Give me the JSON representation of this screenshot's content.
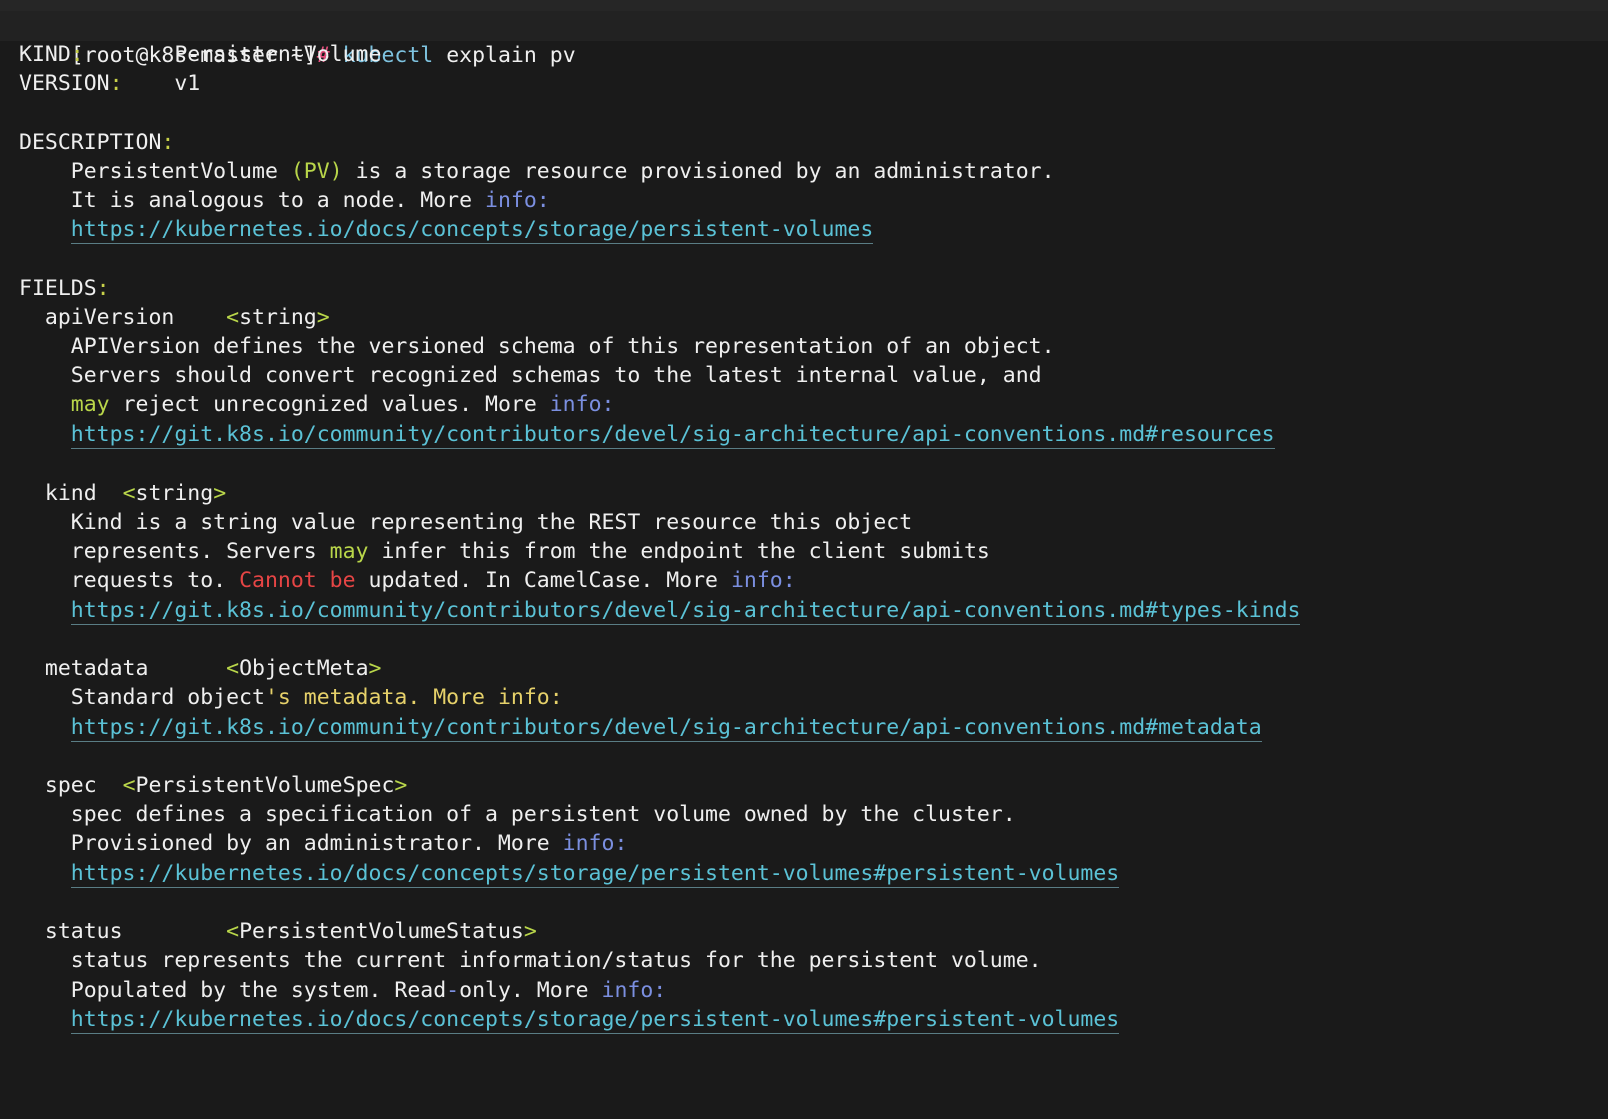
{
  "prompt": {
    "user_host": "[root@k8s-master ~]",
    "hash": "#",
    "command": "kubectl",
    "args": "explain pv"
  },
  "header": {
    "kind_label": "KIND",
    "kind_value": "PersistentVolume",
    "version_label": "VERSION",
    "version_value": "v1"
  },
  "description": {
    "label": "DESCRIPTION",
    "line1_a": "PersistentVolume ",
    "line1_b": "(PV)",
    "line1_c": " is a storage resource provisioned by an administrator.",
    "line2_a": "It is analogous to a node. More ",
    "line2_b": "info",
    "url": "https://kubernetes.io/docs/concepts/storage/persistent-volumes"
  },
  "fields_label": "FIELDS",
  "fields": {
    "apiVersion": {
      "name": "apiVersion",
      "type": "string",
      "line1": "APIVersion defines the versioned schema of this representation of an object.",
      "line2": "Servers should convert recognized schemas to the latest internal value, and",
      "line3_may": "may",
      "line3_rest": " reject unrecognized values. More ",
      "line3_info": "info",
      "url": "https://git.k8s.io/community/contributors/devel/sig-architecture/api-conventions.md#resources"
    },
    "kind": {
      "name": "kind",
      "type": "string",
      "line1": "Kind is a string value representing the REST resource this object",
      "line2_a": "represents. Servers ",
      "line2_may": "may",
      "line2_b": " infer this from the endpoint the client submits",
      "line3_a": "requests to. ",
      "line3_warn": "Cannot be",
      "line3_b": " updated. In CamelCase. More ",
      "line3_info": "info",
      "url": "https://git.k8s.io/community/contributors/devel/sig-architecture/api-conventions.md#types-kinds"
    },
    "metadata": {
      "name": "metadata",
      "type": "ObjectMeta",
      "line1_a": "Standard object",
      "line1_b": "'s metadata. More info",
      "url": "https://git.k8s.io/community/contributors/devel/sig-architecture/api-conventions.md#metadata"
    },
    "spec": {
      "name": "spec",
      "type": "PersistentVolumeSpec",
      "line1": "spec defines a specification of a persistent volume owned by the cluster.",
      "line2_a": "Provisioned by an administrator. More ",
      "line2_info": "info",
      "url": "https://kubernetes.io/docs/concepts/storage/persistent-volumes#persistent-volumes"
    },
    "status": {
      "name": "status",
      "type": "PersistentVolumeStatus",
      "line1": "status represents the current information/status for the persistent volume.",
      "line2_a": "Populated by the system. Read",
      "line2_dash": "-",
      "line2_b": "only. More ",
      "line2_info": "info",
      "url": "https://kubernetes.io/docs/concepts/storage/persistent-volumes#persistent-volumes"
    }
  },
  "colors": {
    "background": "#1a1a1a",
    "text": "#efefef",
    "punctuation": "#c8d14a",
    "prompt_hash": "#e64c7c",
    "command": "#7ec3e0",
    "keyword_info": "#7b8fe0",
    "may": "#b9d64a",
    "warning": "#e64545",
    "link": "#5bc2d6"
  }
}
